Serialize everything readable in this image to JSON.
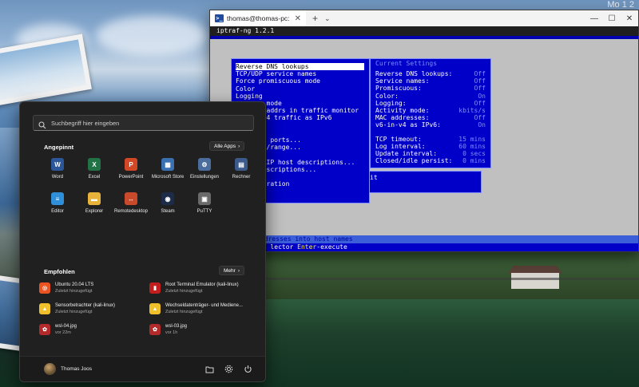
{
  "tray": {
    "line1": "Mo 1 2",
    "line2": "1 2"
  },
  "terminal": {
    "tab_title": "thomas@thomas-pc: /mnt/c/Us",
    "new_tab": "+",
    "dropdown": "⌄",
    "window_controls": [
      "—",
      "☐",
      "✕"
    ],
    "iptraf": {
      "header": "iptraf-ng 1.2.1",
      "menu_items": [
        "Reverse DNS lookups",
        "TCP/UDP service names",
        "Force promiscuous mode",
        "Color",
        "Logging",
        "        mode",
        "      C addrs in traffic monitor",
        "      -v4 traffic as IPv6",
        "",
        "",
        "       l ports...",
        "      rt/range...",
        "",
        "      PLIP host descriptions...",
        "      descriptions...",
        "",
        "     iguration"
      ],
      "menu_exit": "it",
      "settings_title": "Current Settings",
      "settings": [
        {
          "k": "Reverse DNS lookups:",
          "v": "Off"
        },
        {
          "k": "Service names:",
          "v": "Off"
        },
        {
          "k": "Promiscuous:",
          "v": "Off"
        },
        {
          "k": "Color:",
          "v": "On"
        },
        {
          "k": "Logging:",
          "v": "Off"
        },
        {
          "k": "Activity mode:",
          "v": "kbits/s"
        },
        {
          "k": "MAC addresses:",
          "v": "Off"
        },
        {
          "k": "v6-in-v4 as IPv6:",
          "v": "On"
        }
      ],
      "timers": [
        {
          "k": "TCP timeout:",
          "v": "15 mins"
        },
        {
          "k": "Log interval:",
          "v": "60 mins"
        },
        {
          "k": "Update interval:",
          "v": "0 secs"
        },
        {
          "k": "Closed/idle persist:",
          "v": "0 mins"
        }
      ],
      "status_line": "ion of IP addresses into host names",
      "keys_pre": "              lector ",
      "keys_key": "Enter",
      "keys_post": "-execute"
    }
  },
  "start": {
    "search_placeholder": "Suchbegriff hier eingeben",
    "pinned_title": "Angepinnt",
    "all_apps": "Alle Apps",
    "pinned": [
      {
        "label": "Word",
        "glyph": "W",
        "color": "#2b579a"
      },
      {
        "label": "Excel",
        "glyph": "X",
        "color": "#217346"
      },
      {
        "label": "PowerPoint",
        "glyph": "P",
        "color": "#d24726"
      },
      {
        "label": "Microsoft Store",
        "glyph": "▦",
        "color": "#3a6fb0"
      },
      {
        "label": "Einstellungen",
        "glyph": "⚙",
        "color": "#4a6d9e"
      },
      {
        "label": "Rechner",
        "glyph": "▤",
        "color": "#3c5a8a"
      },
      {
        "label": "Editor",
        "glyph": "≡",
        "color": "#2f8fd8"
      },
      {
        "label": "Explorer",
        "glyph": "▬",
        "color": "#e8b33a"
      },
      {
        "label": "Remotedesktop",
        "glyph": "↔",
        "color": "#c84a2a"
      },
      {
        "label": "Steam",
        "glyph": "◉",
        "color": "#1b2b48"
      },
      {
        "label": "PuTTY",
        "glyph": "▣",
        "color": "#6a6a6a"
      }
    ],
    "recommended_title": "Empfohlen",
    "more": "Mehr",
    "recommended": [
      {
        "name": "Ubuntu 20.04 LTS",
        "sub": "Zuletzt hinzugefügt",
        "glyph": "◎",
        "color": "#e95420"
      },
      {
        "name": "Root Terminal Emulator (kali-linux)",
        "sub": "Zuletzt hinzugefügt",
        "glyph": "▮",
        "color": "#c21e1e"
      },
      {
        "name": "Sensorbetrachter (kali-linux)",
        "sub": "Zuletzt hinzugefügt",
        "glyph": "▲",
        "color": "#f0c02a"
      },
      {
        "name": "Wechseldatenträger- und Mediene...",
        "sub": "Zuletzt hinzugefügt",
        "glyph": "▲",
        "color": "#f0c02a"
      },
      {
        "name": "wsl-04.jpg",
        "sub": "vor 22m",
        "glyph": "✿",
        "color": "#b32a2a"
      },
      {
        "name": "wsl-03.jpg",
        "sub": "vor 1h",
        "glyph": "✿",
        "color": "#b32a2a"
      }
    ],
    "user": "Thomas Joos"
  }
}
